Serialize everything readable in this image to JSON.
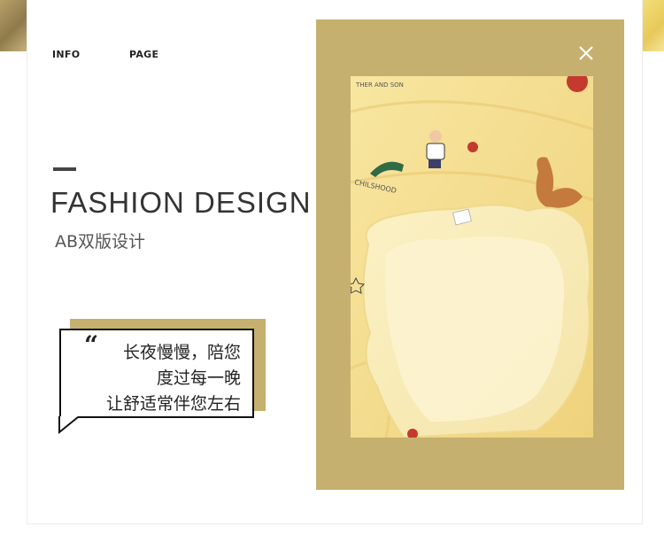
{
  "nav": {
    "info_label": "INFO",
    "page_label": "PAGE"
  },
  "heading": {
    "title": "FASHION DESIGN",
    "subtitle": "AB双版设计"
  },
  "quote": {
    "mark": "“",
    "lines": [
      "长夜慢慢，陪您",
      "度过每一晚",
      "让舒适常伴您左右"
    ]
  },
  "photo": {
    "printed_text_top": "THER AND SON",
    "printed_text_mid": "CHILSHOOD"
  },
  "colors": {
    "accent_gold": "#c6b06f",
    "photo_yellow": "#f6e49a",
    "text_dark": "#333333"
  },
  "icons": {
    "close": "close-icon"
  }
}
